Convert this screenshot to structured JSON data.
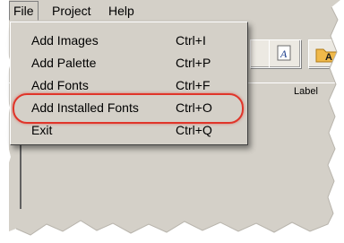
{
  "menubar": {
    "items": [
      {
        "label": "File"
      },
      {
        "label": "Project"
      },
      {
        "label": "Help"
      }
    ]
  },
  "file_menu": {
    "items": [
      {
        "label": "Add Images",
        "shortcut": "Ctrl+I"
      },
      {
        "label": "Add Palette",
        "shortcut": "Ctrl+P"
      },
      {
        "label": "Add Fonts",
        "shortcut": "Ctrl+F"
      },
      {
        "label": "Add Installed Fonts",
        "shortcut": "Ctrl+O",
        "highlighted": true
      },
      {
        "label": "Exit",
        "shortcut": "Ctrl+Q"
      }
    ]
  },
  "table_header": {
    "label": "Label"
  },
  "colors": {
    "chrome": "#d4d0c8",
    "highlight_ring": "#e0352a"
  }
}
